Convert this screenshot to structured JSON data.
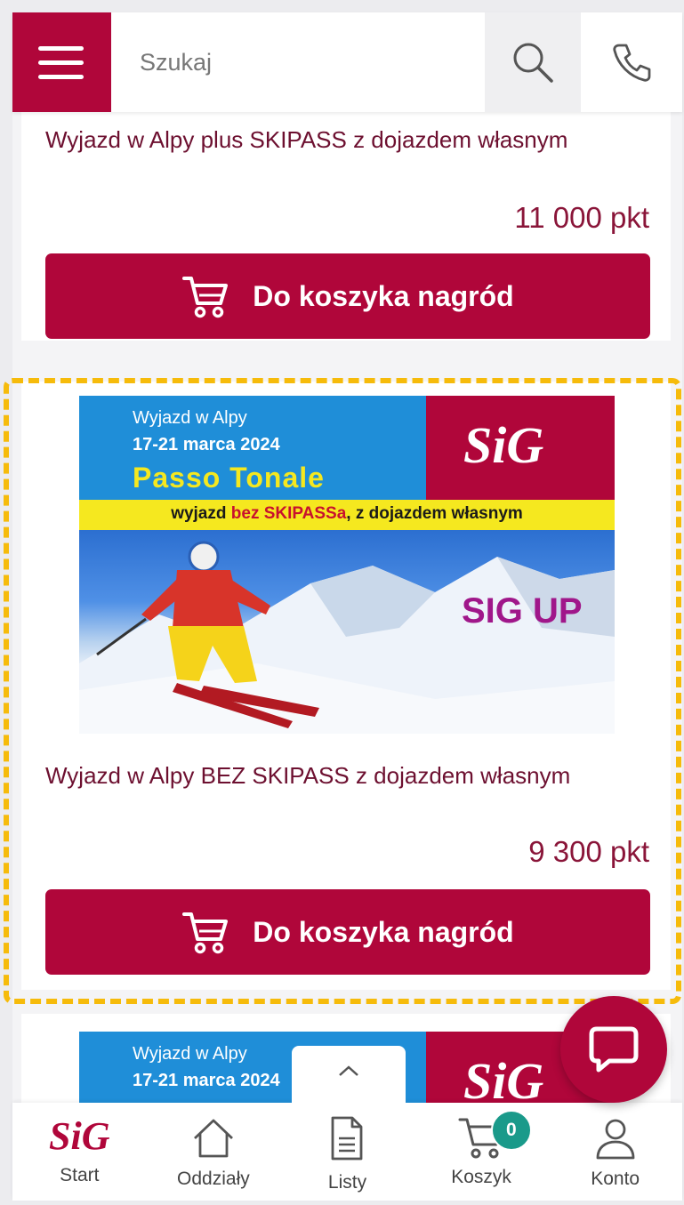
{
  "header": {
    "search_placeholder": "Szukaj",
    "menu_icon": "hamburger-icon",
    "search_icon": "search-icon",
    "phone_icon": "phone-icon"
  },
  "products": [
    {
      "title": "Wyjazd w Alpy plus SKIPASS z dojazdem własnym",
      "price": "11 000 pkt",
      "cart_label": "Do koszyka nagród"
    },
    {
      "title": "Wyjazd w Alpy BEZ SKIPASS z dojazdem własnym",
      "price": "9 300 pkt",
      "cart_label": "Do koszyka nagród",
      "banner": {
        "line1": "Wyjazd w Alpy",
        "dates": "17-21 marca 2024",
        "headline": "Passo Tonale",
        "strip_prefix": "wyjazd ",
        "strip_highlight": "bez SKIPASSa",
        "strip_suffix": ", z dojazdem własnym",
        "logo": "SiG",
        "sub_logo": "SIG UP"
      }
    },
    {
      "banner": {
        "line1": "Wyjazd w Alpy",
        "dates": "17-21 marca 2024",
        "logo": "SiG"
      }
    }
  ],
  "bottom_nav": {
    "items": [
      {
        "label": "Start",
        "icon": "sig-logo-icon"
      },
      {
        "label": "Oddziały",
        "icon": "home-icon"
      },
      {
        "label": "Listy",
        "icon": "document-icon"
      },
      {
        "label": "Koszyk",
        "icon": "cart-icon",
        "badge": "0"
      },
      {
        "label": "Konto",
        "icon": "user-icon"
      }
    ]
  },
  "colors": {
    "brand": "#b0063a",
    "highlight": "#f6bb0b",
    "badge": "#1a9a8a"
  }
}
